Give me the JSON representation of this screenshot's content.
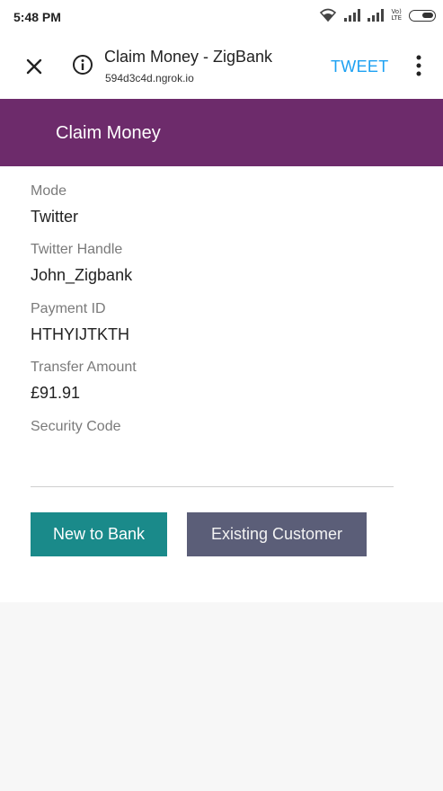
{
  "status_bar": {
    "time": "5:48 PM",
    "network_label": "Vo)\nLTE"
  },
  "browser": {
    "title": "Claim Money - ZigBank",
    "url": "594d3c4d.ngrok.io",
    "action": "TWEET",
    "icons": [
      "close-icon",
      "info-icon",
      "menu-icon"
    ]
  },
  "header": {
    "title": "Claim Money",
    "color": "#6d2b6b"
  },
  "fields": [
    {
      "label": "Mode",
      "value": "Twitter"
    },
    {
      "label": "Twitter Handle",
      "value": "John_Zigbank"
    },
    {
      "label": "Payment ID",
      "value": "HTHYIJTKTH"
    },
    {
      "label": "Transfer Amount",
      "value": "£91.91"
    },
    {
      "label": "Security Code",
      "value": ""
    }
  ],
  "buttons": {
    "new_to_bank": "New to Bank",
    "existing_customer": "Existing Customer"
  },
  "colors": {
    "accent": "#1a8a8a",
    "secondary_button": "#5b5e78",
    "link": "#1da1f2"
  }
}
